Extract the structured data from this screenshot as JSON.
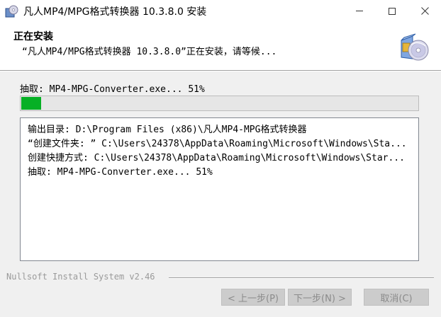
{
  "window": {
    "title": "凡人MP4/MPG格式转换器 10.3.8.0 安装",
    "icon": "installer-app-icon"
  },
  "header": {
    "title": "正在安装",
    "subtitle": "“凡人MP4/MPG格式转换器 10.3.8.0”正在安装，请等候...",
    "icon": "cd-box-icon"
  },
  "progress": {
    "status_text": "抽取: MP4-MPG-Converter.exe... 51%",
    "fraction": 0.05,
    "color": "#06b025"
  },
  "log": {
    "lines": [
      "输出目录: D:\\Program Files (x86)\\凡人MP4-MPG格式转换器",
      "“创建文件夹: ” C:\\Users\\24378\\AppData\\Roaming\\Microsoft\\Windows\\Sta...",
      "创建快捷方式: C:\\Users\\24378\\AppData\\Roaming\\Microsoft\\Windows\\Star...",
      "抽取: MP4-MPG-Converter.exe... 51%"
    ]
  },
  "footer": {
    "branding": "Nullsoft Install System v2.46"
  },
  "buttons": {
    "back": "< 上一步(P)",
    "next": "下一步(N) >",
    "cancel": "取消(C)"
  }
}
